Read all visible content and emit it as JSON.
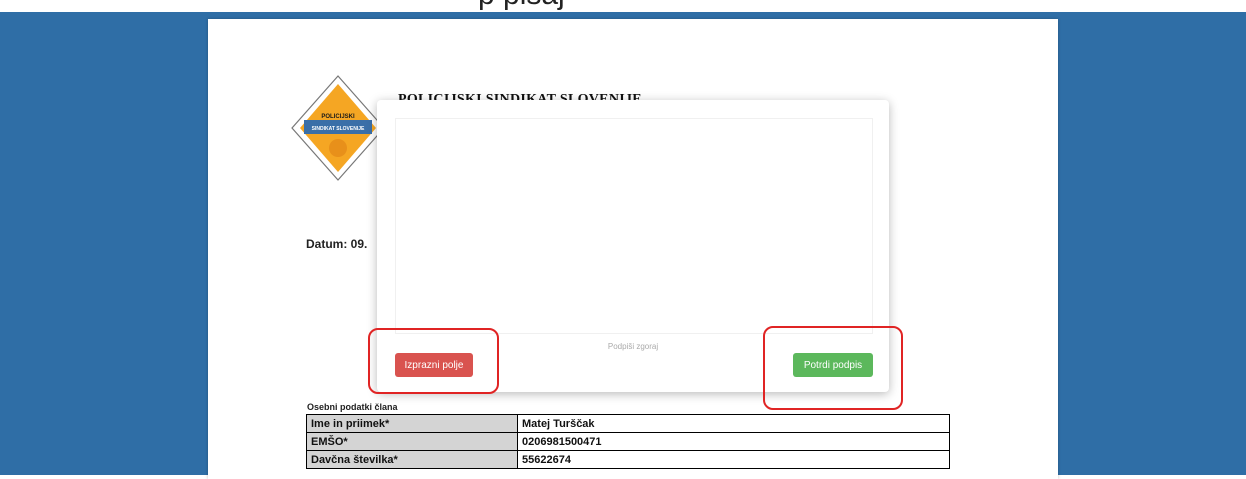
{
  "header": {
    "stray_text": "p                                                        pisaj"
  },
  "document": {
    "org_name": "POLICIJSKI SINDIKAT SLOVENIJE",
    "logo_text_top": "POLICIJSKI",
    "logo_text_bottom": "SINDIKAT SLOVENIJE",
    "date_label": "Datum: 09.",
    "section_title": "Osebni podatki člana",
    "rows": [
      {
        "label": "Ime in priimek*",
        "value": "Matej Turščak"
      },
      {
        "label": "EMŠO*",
        "value": "0206981500471"
      },
      {
        "label": "Davčna številka*",
        "value": "55622674"
      }
    ]
  },
  "modal": {
    "hint": "Podpiši zgoraj",
    "clear_label": "Izprazni polje",
    "confirm_label": "Potrdi podpis"
  },
  "colors": {
    "backdrop": "#2f6ea6",
    "clear_button": "#d9534f",
    "confirm_button": "#5cb85c",
    "highlight": "#e02424"
  }
}
